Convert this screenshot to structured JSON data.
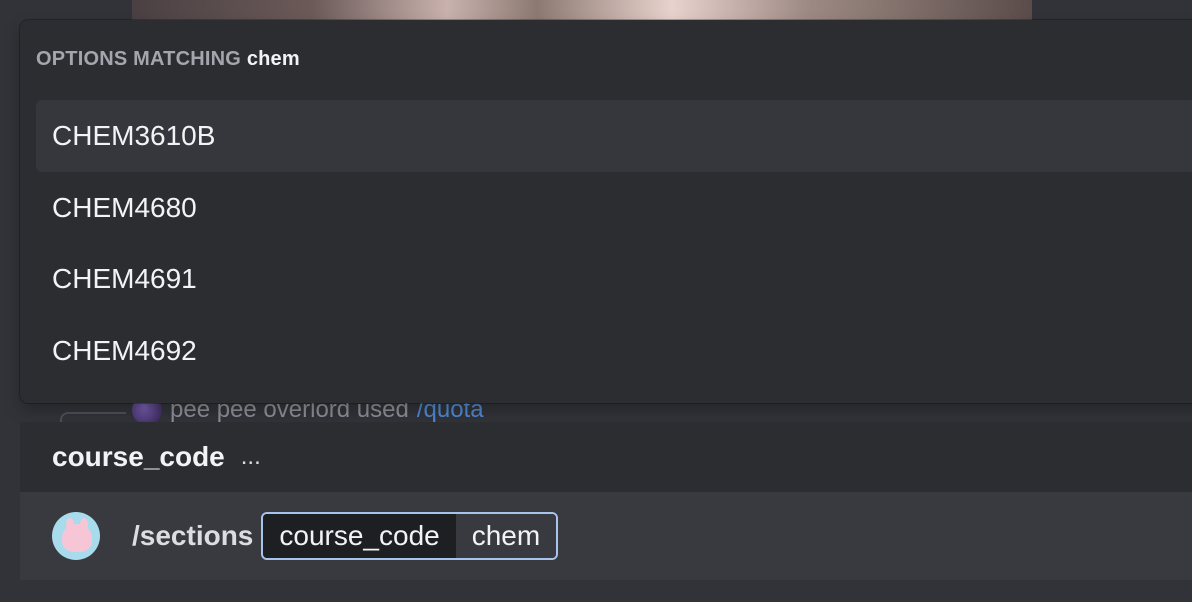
{
  "autocomplete": {
    "header_prefix": "OPTIONS MATCHING",
    "query": "chem",
    "options": [
      {
        "label": "CHEM3610B",
        "selected": true
      },
      {
        "label": "CHEM4680",
        "selected": false
      },
      {
        "label": "CHEM4691",
        "selected": false
      },
      {
        "label": "CHEM4692",
        "selected": false
      }
    ]
  },
  "background_message": {
    "user": "pee pee overlord used",
    "command": "/quota"
  },
  "option_bar": {
    "name": "course_code",
    "description": "..."
  },
  "composer": {
    "command": "/sections",
    "option_name": "course_code",
    "option_value": "chem"
  },
  "colors": {
    "background": "#313338",
    "popup": "#2b2d31",
    "selected": "#35373c",
    "accent_border": "#a9c4ea",
    "link": "#4f8ad6"
  }
}
